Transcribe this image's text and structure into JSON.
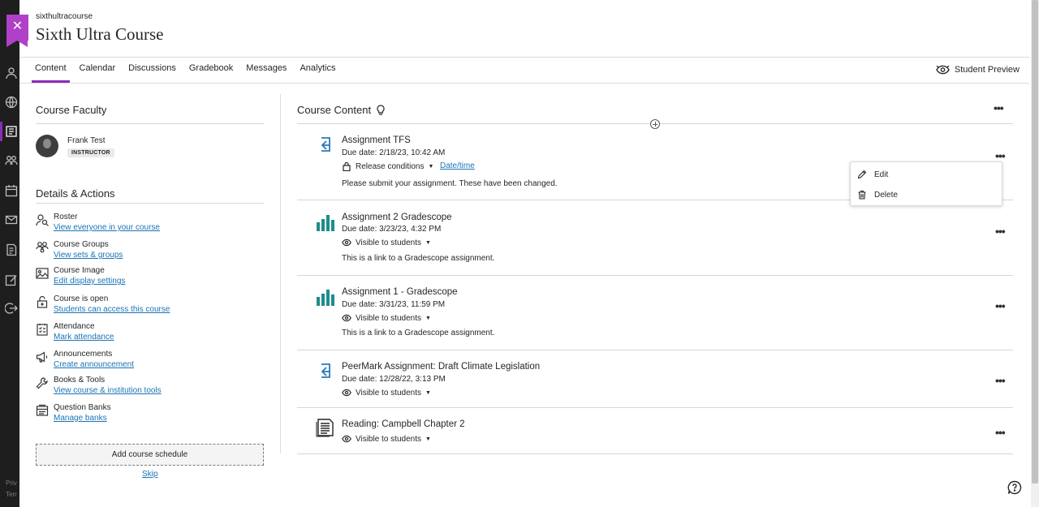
{
  "course": {
    "code": "sixthultracourse",
    "title": "Sixth Ultra Course"
  },
  "close": {
    "icon": "close-icon",
    "glyph": "✕"
  },
  "tabs": [
    {
      "label": "Content",
      "active": true
    },
    {
      "label": "Calendar",
      "active": false
    },
    {
      "label": "Discussions",
      "active": false
    },
    {
      "label": "Gradebook",
      "active": false
    },
    {
      "label": "Messages",
      "active": false
    },
    {
      "label": "Analytics",
      "active": false
    }
  ],
  "student_preview": {
    "label": "Student Preview",
    "icon": "eye-preview-icon"
  },
  "rail_footer": {
    "line1": "Priv",
    "line2": "Terr"
  },
  "faculty": {
    "title": "Course Faculty",
    "name": "Frank Test",
    "role": "INSTRUCTOR"
  },
  "details": {
    "title": "Details & Actions",
    "items": [
      {
        "label": "Roster",
        "link": "View everyone in your course",
        "icon": "roster-icon"
      },
      {
        "label": "Course Groups",
        "link": "View sets & groups",
        "icon": "groups-icon"
      },
      {
        "label": "Course Image",
        "link": "Edit display settings",
        "icon": "image-icon"
      },
      {
        "label": "Course is open",
        "link": "Students can access this course",
        "icon": "unlock-icon"
      },
      {
        "label": "Attendance",
        "link": "Mark attendance",
        "icon": "attendance-icon"
      },
      {
        "label": "Announcements",
        "link": "Create announcement",
        "icon": "megaphone-icon"
      },
      {
        "label": "Books & Tools",
        "link": "View course & institution tools",
        "icon": "wrench-icon"
      },
      {
        "label": "Question Banks",
        "link": "Manage banks",
        "icon": "question-bank-icon"
      }
    ],
    "add_schedule": "Add course schedule",
    "skip": "Skip"
  },
  "content": {
    "title": "Course Content",
    "items": [
      {
        "title": "Assignment TFS",
        "due": "Due date: 2/18/23, 10:42 AM",
        "visibility": "Release conditions",
        "visibility_link": "Date/time",
        "description": "Please submit your assignment. These have been changed.",
        "icon": "assignment-icon"
      },
      {
        "title": "Assignment 2 Gradescope",
        "due": "Due date: 3/23/23, 4:32 PM",
        "visibility": "Visible to students",
        "description": "This is a link to a Gradescope assignment.",
        "icon": "bar-chart-icon"
      },
      {
        "title": "Assignment 1 - Gradescope",
        "due": "Due date: 3/31/23, 11:59 PM",
        "visibility": "Visible to students",
        "description": "This is a link to a Gradescope assignment.",
        "icon": "bar-chart-icon"
      },
      {
        "title": "PeerMark Assignment: Draft Climate Legislation",
        "due": "Due date: 12/28/22, 3:13 PM",
        "visibility": "Visible to students",
        "icon": "assignment-icon"
      },
      {
        "title": "Reading: Campbell Chapter 2",
        "visibility": "Visible to students",
        "icon": "document-icon"
      }
    ]
  },
  "item_menu": {
    "edit": "Edit",
    "delete": "Delete"
  },
  "colors": {
    "accent": "#8b2bb9",
    "link": "#1a73b5",
    "teal": "#1f8c8c",
    "blue": "#2a7ab8"
  }
}
